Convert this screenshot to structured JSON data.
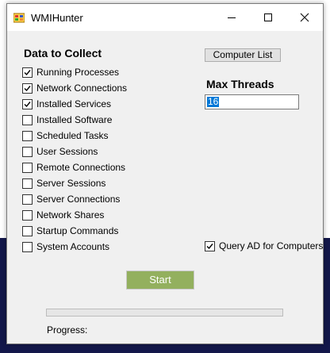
{
  "window": {
    "title": "WMIHunter"
  },
  "data_section": {
    "title": "Data to Collect",
    "items": [
      {
        "label": "Running Processes",
        "checked": true
      },
      {
        "label": "Network Connections",
        "checked": true
      },
      {
        "label": "Installed Services",
        "checked": true
      },
      {
        "label": "Installed Software",
        "checked": false
      },
      {
        "label": "Scheduled Tasks",
        "checked": false
      },
      {
        "label": "User Sessions",
        "checked": false
      },
      {
        "label": "Remote Connections",
        "checked": false
      },
      {
        "label": "Server Sessions",
        "checked": false
      },
      {
        "label": "Server Connections",
        "checked": false
      },
      {
        "label": "Network Shares",
        "checked": false
      },
      {
        "label": "Startup Commands",
        "checked": false
      },
      {
        "label": "System Accounts",
        "checked": false
      }
    ]
  },
  "computer_list_button": "Computer List",
  "max_threads": {
    "title": "Max Threads",
    "value": "16"
  },
  "query_ad": {
    "label": "Query AD for Computers",
    "checked": true
  },
  "start_button": "Start",
  "progress": {
    "label": "Progress:",
    "value": 0
  },
  "colors": {
    "start_button": "#93b05e",
    "selection": "#0078d7"
  },
  "icons": [
    "app-icon",
    "minimize-icon",
    "maximize-icon",
    "close-icon",
    "checkmark-icon"
  ]
}
